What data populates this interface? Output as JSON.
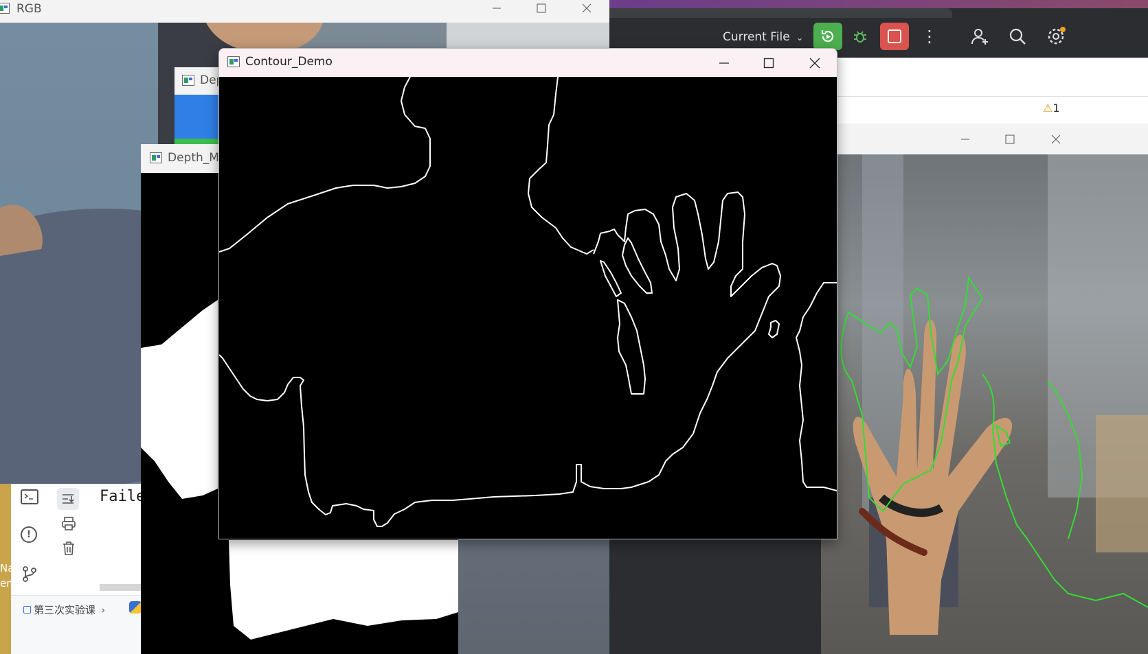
{
  "windows": {
    "rgb": {
      "title": "RGB"
    },
    "depth_small": {
      "title": "Dep"
    },
    "depth_map": {
      "title": "Depth_Ma"
    },
    "contour": {
      "title": "Contour_Demo"
    }
  },
  "ide": {
    "run_config": "Current File",
    "warning_count": "1",
    "terminal_text": "Faile",
    "breadcrumb": "第三次实验课",
    "partial_left_text": [
      "Na",
      "em"
    ]
  },
  "colors": {
    "ide_bg": "#2b2d30",
    "run_green": "#4caf50",
    "stop_red": "#d9534f",
    "contour_green": "#33dd33"
  },
  "icons": [
    "chevron-down-icon",
    "run-icon",
    "debug-icon",
    "stop-icon",
    "more-icon",
    "add-user-icon",
    "search-icon",
    "settings-icon",
    "warning-icon",
    "terminal-icon",
    "problems-icon",
    "git-icon",
    "scroll-end-icon",
    "print-icon",
    "trash-icon",
    "python-icon",
    "minimize-icon",
    "maximize-icon",
    "close-icon"
  ]
}
